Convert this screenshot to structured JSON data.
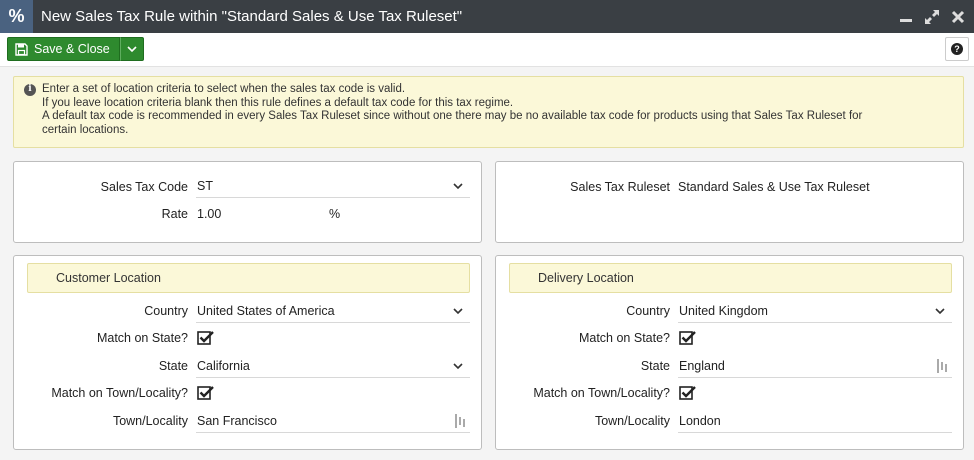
{
  "window": {
    "icon": "percent-icon",
    "icon_glyph": "%",
    "title": "New Sales Tax Rule within \"Standard Sales & Use Tax Ruleset\""
  },
  "toolbar": {
    "save_label": "Save & Close",
    "help_glyph": "?"
  },
  "info": {
    "glyph": "i",
    "lines": [
      "Enter a set of location criteria to select when the sales tax code is valid.",
      "If you leave location criteria blank then this rule defines a default tax code for this tax regime.",
      "A default tax code is recommended in every Sales Tax Ruleset since without one there may be no available tax code for products using that Sales Tax Ruleset for",
      "certain locations."
    ]
  },
  "tax": {
    "code_label": "Sales Tax Code",
    "code_value": "ST",
    "rate_label": "Rate",
    "rate_value": "1.00",
    "rate_unit": "%",
    "ruleset_label": "Sales Tax Ruleset",
    "ruleset_value": "Standard Sales & Use Tax Ruleset"
  },
  "customer": {
    "heading": "Customer Location",
    "country_label": "Country",
    "country_value": "United States of America",
    "match_state_label": "Match on State?",
    "match_state": true,
    "state_label": "State",
    "state_value": "California",
    "match_town_label": "Match on Town/Locality?",
    "match_town": true,
    "town_label": "Town/Locality",
    "town_value": "San Francisco"
  },
  "delivery": {
    "heading": "Delivery Location",
    "country_label": "Country",
    "country_value": "United Kingdom",
    "match_state_label": "Match on State?",
    "match_state": true,
    "state_label": "State",
    "state_value": "England",
    "match_town_label": "Match on Town/Locality?",
    "match_town": true,
    "town_label": "Town/Locality",
    "town_value": "London"
  },
  "colors": {
    "titlebar": "#3a3f44",
    "save_green": "#2e8a2e",
    "info_bg": "#fbf8d8"
  }
}
